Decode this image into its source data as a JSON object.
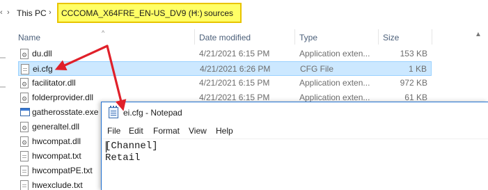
{
  "explorer": {
    "breadcrumb": {
      "this_pc": "This PC",
      "drive": "CCCOMA_X64FRE_EN-US_DV9 (H:)",
      "folder": "sources",
      "highlight_color": "#ffff66"
    },
    "columns": {
      "name": "Name",
      "date_modified": "Date modified",
      "type": "Type",
      "size": "Size"
    },
    "files": [
      {
        "name": "du.dll",
        "date": "4/21/2021 6:15 PM",
        "type": "Application exten...",
        "size": "153 KB",
        "icon": "dll-file-icon"
      },
      {
        "name": "ei.cfg",
        "date": "4/21/2021 6:26 PM",
        "type": "CFG File",
        "size": "1 KB",
        "icon": "text-file-icon",
        "selected": true
      },
      {
        "name": "facilitator.dll",
        "date": "4/21/2021 6:15 PM",
        "type": "Application exten...",
        "size": "972 KB",
        "icon": "dll-file-icon"
      },
      {
        "name": "folderprovider.dll",
        "date": "4/21/2021 6:15 PM",
        "type": "Application exten...",
        "size": "61 KB",
        "icon": "dll-file-icon"
      },
      {
        "name": "gatherosstate.exe",
        "date": "",
        "type": "",
        "size": "",
        "icon": "exe-file-icon"
      },
      {
        "name": "generaltel.dll",
        "date": "",
        "type": "",
        "size": "",
        "icon": "dll-file-icon"
      },
      {
        "name": "hwcompat.dll",
        "date": "",
        "type": "",
        "size": "",
        "icon": "dll-file-icon"
      },
      {
        "name": "hwcompat.txt",
        "date": "",
        "type": "",
        "size": "",
        "icon": "text-file-icon"
      },
      {
        "name": "hwcompatPE.txt",
        "date": "",
        "type": "",
        "size": "",
        "icon": "text-file-icon"
      },
      {
        "name": "hwexclude.txt",
        "date": "",
        "type": "",
        "size": "",
        "icon": "text-file-icon"
      }
    ]
  },
  "annotation": {
    "arrow_color": "#e0202a"
  },
  "notepad": {
    "title": "ei.cfg - Notepad",
    "menu": [
      "File",
      "Edit",
      "Format",
      "View",
      "Help"
    ],
    "content_lines": [
      "[Channel]",
      "Retail"
    ],
    "accent_color": "#1f6fd0"
  }
}
